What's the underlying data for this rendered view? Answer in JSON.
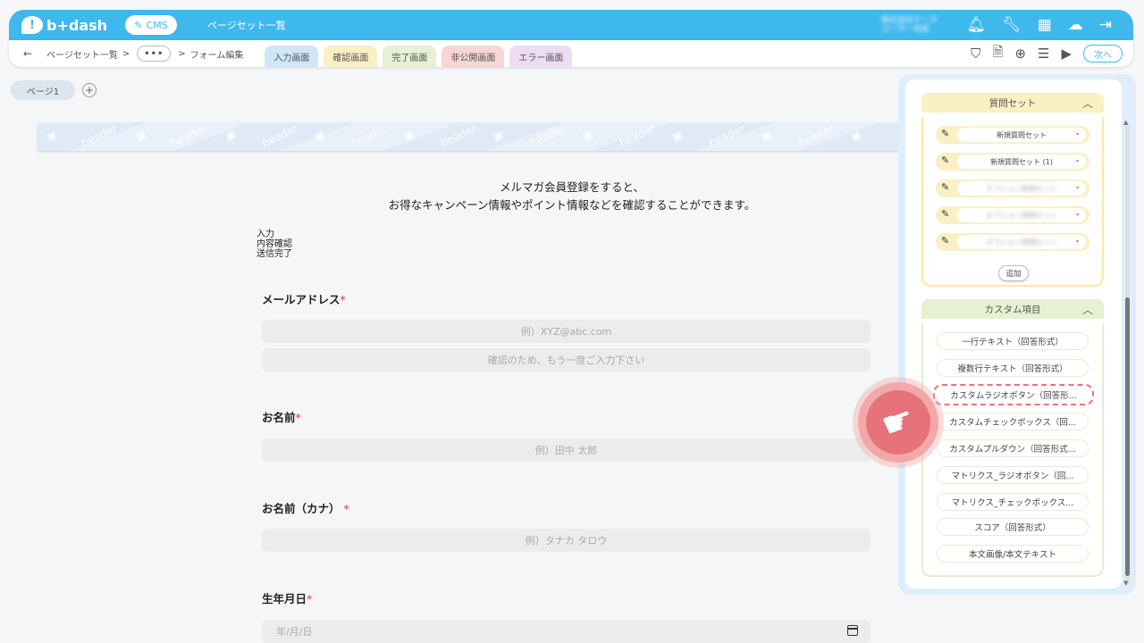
{
  "topbar": {
    "logo_text": "b+dash",
    "cms_label": "CMS",
    "title": "ページセット一覧",
    "user_line1": "株式会社データ",
    "user_line2": "ユーザー名前"
  },
  "breadcrumb": {
    "back": "←",
    "item1": "ページセット一覧",
    "sep": ">",
    "more": "•••",
    "current": "フォーム編集"
  },
  "tabs": [
    {
      "label": "入力画面"
    },
    {
      "label": "確認画面"
    },
    {
      "label": "完了画面"
    },
    {
      "label": "非公開画面"
    },
    {
      "label": "エラー画面"
    }
  ],
  "next_label": "次へ",
  "page_tabs": {
    "page1": "ページ1",
    "add": "+"
  },
  "banner_word": "header",
  "intro": {
    "line1": "メルマガ会員登録をすると、",
    "line2": "お得なキャンペーン情報やポイント情報などを確認することができます。"
  },
  "steps": [
    "入力",
    "内容確認",
    "送信完了"
  ],
  "form": {
    "email_label": "メールアドレス",
    "email_placeholder": "例）XYZ@abc.com",
    "email_confirm_placeholder": "確認のため、もう一度ご入力下さい",
    "name_label": "お名前",
    "name_placeholder": "例）田中 太郎",
    "kana_label": "お名前（カナ）",
    "kana_placeholder": "例）タナカ タロウ",
    "birth_label": "生年月日",
    "birth_placeholder": "年/月/日",
    "required_mark": "*"
  },
  "panel": {
    "question_set_header": "質問セット",
    "question_sets": [
      "新規質問セット",
      "新規質問セット (1)",
      "オプション質問セット",
      "オプション質問セット",
      "オプション質問セット"
    ],
    "add_label": "追加",
    "custom_header": "カスタム項目",
    "custom_items": [
      "一行テキスト（回答形式）",
      "複数行テキスト（回答形式）",
      "カスタムラジオボタン（回答形...",
      "カスタムチェックボックス（回...",
      "カスタムプルダウン（回答形式...",
      "マトリクス_ラジオボタン（回...",
      "マトリクス_チェックボックス...",
      "スコア（回答形式）",
      "本文画像/本文テキスト"
    ]
  }
}
